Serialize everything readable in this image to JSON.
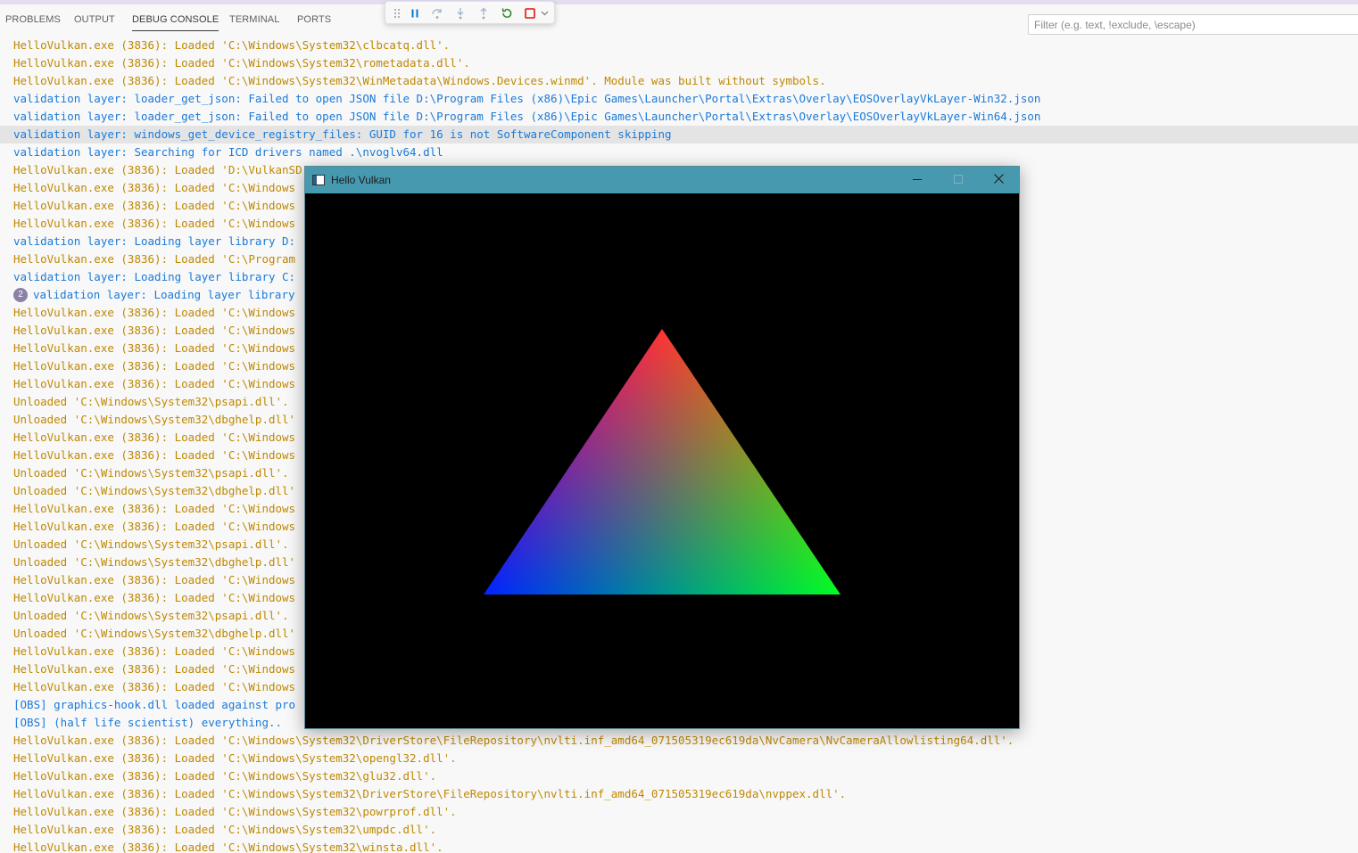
{
  "panel_tabs": [
    "PROBLEMS",
    "OUTPUT",
    "DEBUG CONSOLE",
    "TERMINAL",
    "PORTS"
  ],
  "active_tab": "DEBUG CONSOLE",
  "filter": {
    "placeholder": "Filter (e.g. text, !exclude, \\escape)",
    "value": ""
  },
  "debug_toolbar": [
    "drag-handle-icon",
    "pause-icon",
    "step-over-icon",
    "step-into-icon",
    "step-out-icon",
    "restart-icon",
    "stop-icon",
    "chevron-down-icon"
  ],
  "colors": {
    "loader_text": "#bf8803",
    "layer_text": "#1a7ad8",
    "title_bar": "#4799b0",
    "badge": "#8c7fa8",
    "stop": "#e51400",
    "restart": "#388a34",
    "debug_icons": "#007acc"
  },
  "console_lines": [
    {
      "text": "HelloVulkan.exe (3836): Loaded 'C:\\Windows\\System32\\clbcatq.dll'.",
      "kind": "o"
    },
    {
      "text": "HelloVulkan.exe (3836): Loaded 'C:\\Windows\\System32\\rometadata.dll'.",
      "kind": "o"
    },
    {
      "text": "HelloVulkan.exe (3836): Loaded 'C:\\Windows\\System32\\WinMetadata\\Windows.Devices.winmd'. Module was built without symbols.",
      "kind": "o"
    },
    {
      "text": "validation layer: loader_get_json: Failed to open JSON file D:\\Program Files (x86)\\Epic Games\\Launcher\\Portal\\Extras\\Overlay\\EOSOverlayVkLayer-Win32.json",
      "kind": "b"
    },
    {
      "text": "validation layer: loader_get_json: Failed to open JSON file D:\\Program Files (x86)\\Epic Games\\Launcher\\Portal\\Extras\\Overlay\\EOSOverlayVkLayer-Win64.json",
      "kind": "b"
    },
    {
      "text": "validation layer: windows_get_device_registry_files: GUID for 16 is not SoftwareComponent skipping",
      "kind": "b",
      "highlight": true
    },
    {
      "text": "validation layer: Searching for ICD drivers named .\\nvoglv64.dll",
      "kind": "b"
    },
    {
      "text": "HelloVulkan.exe (3836): Loaded 'D:\\VulkanSD",
      "kind": "o"
    },
    {
      "text": "HelloVulkan.exe (3836): Loaded 'C:\\Windows",
      "kind": "o"
    },
    {
      "text": "HelloVulkan.exe (3836): Loaded 'C:\\Windows",
      "kind": "o"
    },
    {
      "text": "HelloVulkan.exe (3836): Loaded 'C:\\Windows",
      "kind": "o"
    },
    {
      "text": "validation layer: Loading layer library D:",
      "kind": "b"
    },
    {
      "text": "HelloVulkan.exe (3836): Loaded 'C:\\Program",
      "kind": "o"
    },
    {
      "text": "validation layer: Loading layer library C:",
      "kind": "b"
    },
    {
      "text": "validation layer: Loading layer library",
      "kind": "b",
      "badge": "2"
    },
    {
      "text": "HelloVulkan.exe (3836): Loaded 'C:\\Windows",
      "kind": "o"
    },
    {
      "text": "HelloVulkan.exe (3836): Loaded 'C:\\Windows",
      "kind": "o"
    },
    {
      "text": "HelloVulkan.exe (3836): Loaded 'C:\\Windows",
      "kind": "o"
    },
    {
      "text": "HelloVulkan.exe (3836): Loaded 'C:\\Windows",
      "kind": "o"
    },
    {
      "text": "HelloVulkan.exe (3836): Loaded 'C:\\Windows",
      "kind": "o"
    },
    {
      "text": "Unloaded 'C:\\Windows\\System32\\psapi.dll'.",
      "kind": "o"
    },
    {
      "text": "Unloaded 'C:\\Windows\\System32\\dbghelp.dll'",
      "kind": "o"
    },
    {
      "text": "HelloVulkan.exe (3836): Loaded 'C:\\Windows",
      "kind": "o"
    },
    {
      "text": "HelloVulkan.exe (3836): Loaded 'C:\\Windows",
      "kind": "o"
    },
    {
      "text": "Unloaded 'C:\\Windows\\System32\\psapi.dll'.",
      "kind": "o"
    },
    {
      "text": "Unloaded 'C:\\Windows\\System32\\dbghelp.dll'",
      "kind": "o"
    },
    {
      "text": "HelloVulkan.exe (3836): Loaded 'C:\\Windows",
      "kind": "o"
    },
    {
      "text": "HelloVulkan.exe (3836): Loaded 'C:\\Windows",
      "kind": "o"
    },
    {
      "text": "Unloaded 'C:\\Windows\\System32\\psapi.dll'.",
      "kind": "o"
    },
    {
      "text": "Unloaded 'C:\\Windows\\System32\\dbghelp.dll'",
      "kind": "o"
    },
    {
      "text": "HelloVulkan.exe (3836): Loaded 'C:\\Windows",
      "kind": "o"
    },
    {
      "text": "HelloVulkan.exe (3836): Loaded 'C:\\Windows",
      "kind": "o"
    },
    {
      "text": "Unloaded 'C:\\Windows\\System32\\psapi.dll'.",
      "kind": "o"
    },
    {
      "text": "Unloaded 'C:\\Windows\\System32\\dbghelp.dll'",
      "kind": "o"
    },
    {
      "text": "HelloVulkan.exe (3836): Loaded 'C:\\Windows",
      "kind": "o"
    },
    {
      "text": "HelloVulkan.exe (3836): Loaded 'C:\\Windows",
      "kind": "o"
    },
    {
      "text": "HelloVulkan.exe (3836): Loaded 'C:\\Windows",
      "kind": "o"
    },
    {
      "text": "[OBS] graphics-hook.dll loaded against pro",
      "kind": "b"
    },
    {
      "text": "[OBS] (half life scientist) everything..",
      "kind": "b"
    },
    {
      "text": "HelloVulkan.exe (3836): Loaded 'C:\\Windows\\System32\\DriverStore\\FileRepository\\nvlti.inf_amd64_071505319ec619da\\NvCamera\\NvCameraAllowlisting64.dll'.",
      "kind": "o"
    },
    {
      "text": "HelloVulkan.exe (3836): Loaded 'C:\\Windows\\System32\\opengl32.dll'.",
      "kind": "o"
    },
    {
      "text": "HelloVulkan.exe (3836): Loaded 'C:\\Windows\\System32\\glu32.dll'.",
      "kind": "o"
    },
    {
      "text": "HelloVulkan.exe (3836): Loaded 'C:\\Windows\\System32\\DriverStore\\FileRepository\\nvlti.inf_amd64_071505319ec619da\\nvppex.dll'.",
      "kind": "o"
    },
    {
      "text": "HelloVulkan.exe (3836): Loaded 'C:\\Windows\\System32\\powrprof.dll'.",
      "kind": "o"
    },
    {
      "text": "HelloVulkan.exe (3836): Loaded 'C:\\Windows\\System32\\umpdc.dll'.",
      "kind": "o"
    },
    {
      "text": "HelloVulkan.exe (3836): Loaded 'C:\\Windows\\System32\\winsta.dll'.",
      "kind": "o"
    }
  ],
  "window": {
    "title": "Hello Vulkan",
    "controls": [
      "minimize-icon",
      "maximize-icon",
      "close-icon"
    ],
    "triangle_vertex_colors": {
      "top": "#ff0000",
      "bottom_right": "#00ff00",
      "bottom_left": "#0000ff"
    }
  }
}
